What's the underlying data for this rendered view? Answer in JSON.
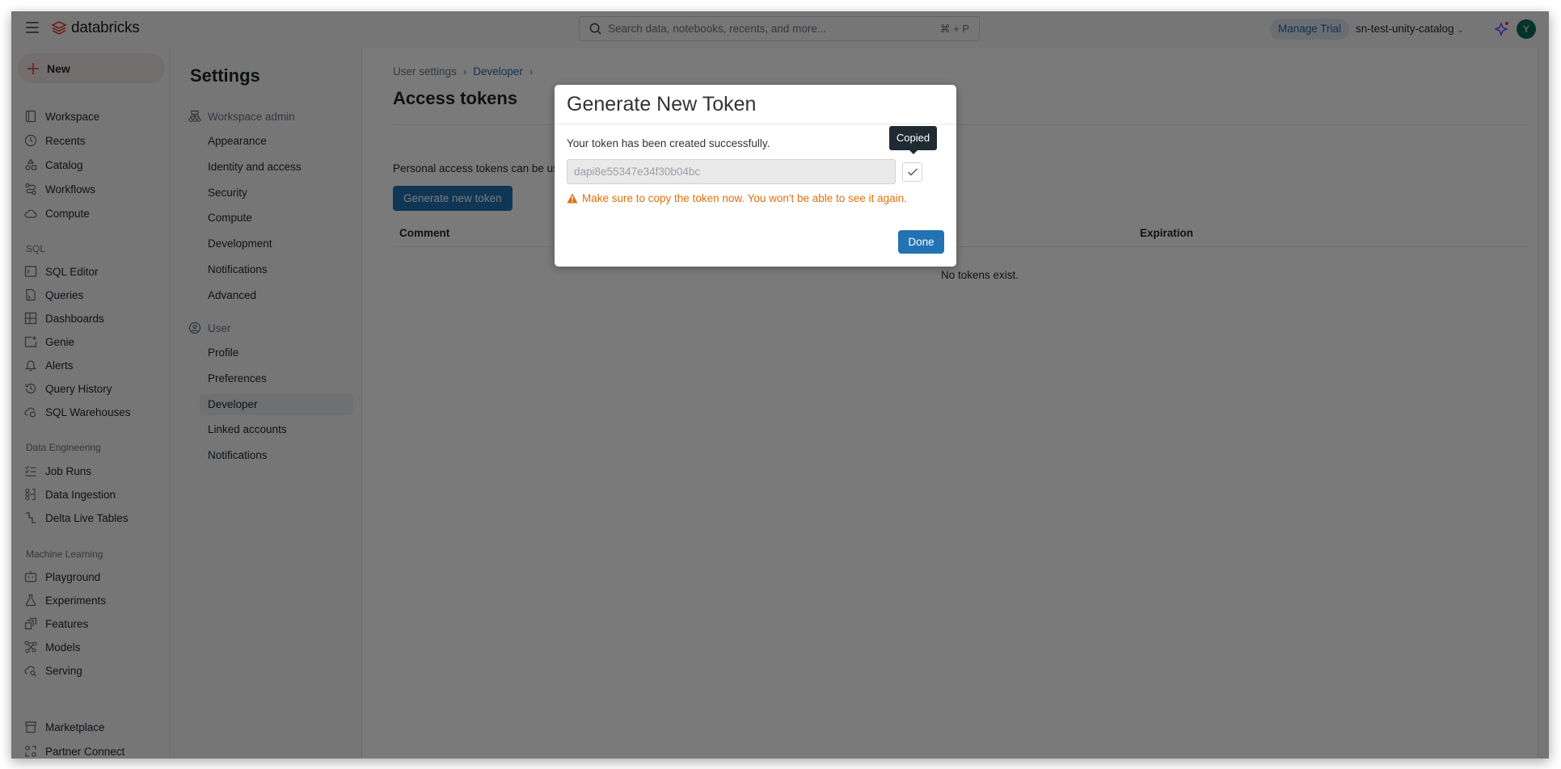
{
  "topbar": {
    "logo_text": "databricks",
    "search_placeholder": "Search data, notebooks, recents, and more...",
    "search_shortcut": "⌘ + P",
    "manage_trial": "Manage Trial",
    "workspace_name": "sn-test-unity-catalog",
    "avatar_initial": "Y"
  },
  "sidebar": {
    "new_label": "New",
    "items": [
      {
        "label": "Workspace",
        "icon": "workspace-icon"
      },
      {
        "label": "Recents",
        "icon": "clock-icon"
      },
      {
        "label": "Catalog",
        "icon": "catalog-icon"
      },
      {
        "label": "Workflows",
        "icon": "workflows-icon"
      },
      {
        "label": "Compute",
        "icon": "cloud-icon"
      }
    ],
    "sql_section": "SQL",
    "sql_items": [
      {
        "label": "SQL Editor",
        "icon": "sql-editor-icon"
      },
      {
        "label": "Queries",
        "icon": "query-icon"
      },
      {
        "label": "Dashboards",
        "icon": "dashboard-icon"
      },
      {
        "label": "Genie",
        "icon": "genie-icon"
      },
      {
        "label": "Alerts",
        "icon": "bell-icon"
      },
      {
        "label": "Query History",
        "icon": "history-icon"
      },
      {
        "label": "SQL Warehouses",
        "icon": "warehouse-icon"
      }
    ],
    "de_section": "Data Engineering",
    "de_items": [
      {
        "label": "Job Runs",
        "icon": "job-runs-icon"
      },
      {
        "label": "Data Ingestion",
        "icon": "ingestion-icon"
      },
      {
        "label": "Delta Live Tables",
        "icon": "pipeline-icon"
      }
    ],
    "ml_section": "Machine Learning",
    "ml_items": [
      {
        "label": "Playground",
        "icon": "robot-icon"
      },
      {
        "label": "Experiments",
        "icon": "flask-icon"
      },
      {
        "label": "Features",
        "icon": "features-icon"
      },
      {
        "label": "Models",
        "icon": "models-icon"
      },
      {
        "label": "Serving",
        "icon": "serving-icon"
      }
    ],
    "bottom_items": [
      {
        "label": "Marketplace",
        "icon": "store-icon"
      },
      {
        "label": "Partner Connect",
        "icon": "partner-icon"
      }
    ]
  },
  "settings_nav": {
    "title": "Settings",
    "admin_group": "Workspace admin",
    "admin_items": [
      "Appearance",
      "Identity and access",
      "Security",
      "Compute",
      "Development",
      "Notifications",
      "Advanced"
    ],
    "user_group": "User",
    "user_items": [
      "Profile",
      "Preferences",
      "Developer",
      "Linked accounts",
      "Notifications"
    ],
    "active_item": "Developer"
  },
  "content": {
    "breadcrumb": [
      "User settings",
      "Developer"
    ],
    "title": "Access tokens",
    "description": "Personal access tokens can be used",
    "generate_button": "Generate new token",
    "columns": [
      "Comment",
      "Expiration"
    ],
    "empty_message": "No tokens exist."
  },
  "modal": {
    "title": "Generate New Token",
    "message": "Your token has been created successfully.",
    "token_value": "dapi8e55347e34f30b04bc",
    "tooltip": "Copied",
    "warning": "Make sure to copy the token now. You won't be able to see it again.",
    "done_label": "Done"
  },
  "colors": {
    "accent": "#2272b4",
    "warning": "#e07010",
    "brand": "#e0422f",
    "avatar": "#0b6b55"
  }
}
